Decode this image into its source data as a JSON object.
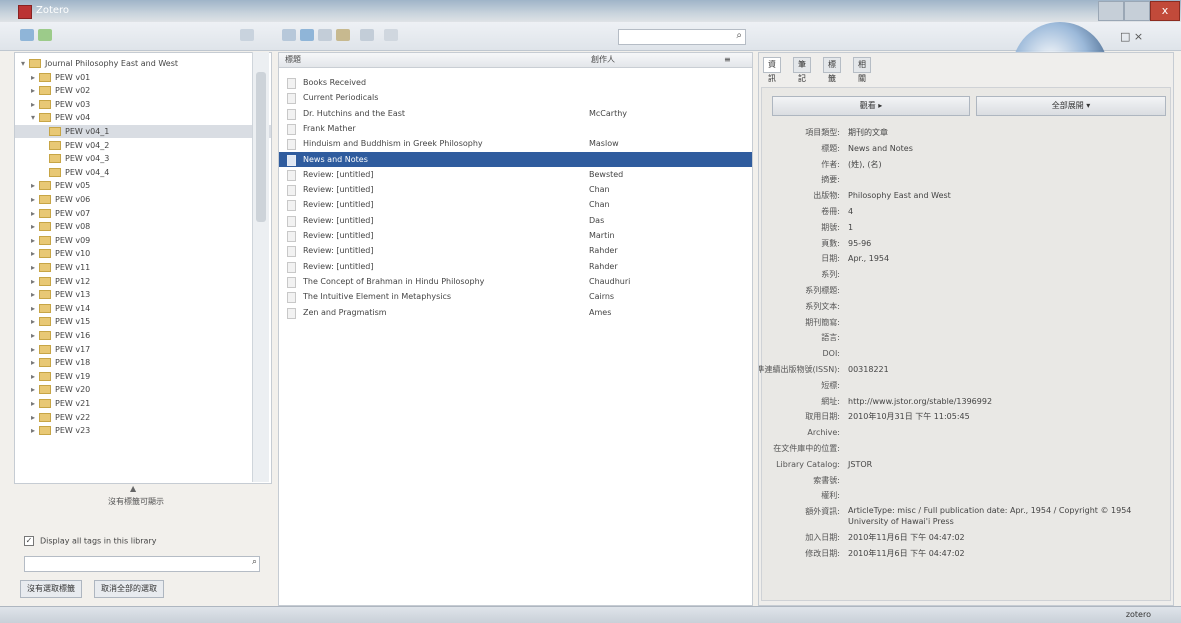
{
  "window": {
    "title": "Zotero",
    "close_label": "x"
  },
  "toolbar": {
    "search_placeholder": "",
    "search_icon": "search-icon"
  },
  "collections": [
    {
      "label": "Journal Philosophy East and West",
      "twisty": "▾",
      "level": 0
    },
    {
      "label": "PEW v01",
      "twisty": "▸",
      "level": 1
    },
    {
      "label": "PEW v02",
      "twisty": "▸",
      "level": 1
    },
    {
      "label": "PEW v03",
      "twisty": "▸",
      "level": 1
    },
    {
      "label": "PEW v04",
      "twisty": "▾",
      "level": 1
    },
    {
      "label": "PEW v04_1",
      "twisty": "",
      "level": 2
    },
    {
      "label": "PEW v04_2",
      "twisty": "",
      "level": 2
    },
    {
      "label": "PEW v04_3",
      "twisty": "",
      "level": 2
    },
    {
      "label": "PEW v04_4",
      "twisty": "",
      "level": 2
    },
    {
      "label": "PEW v05",
      "twisty": "▸",
      "level": 1
    },
    {
      "label": "PEW v06",
      "twisty": "▸",
      "level": 1
    },
    {
      "label": "PEW v07",
      "twisty": "▸",
      "level": 1
    },
    {
      "label": "PEW v08",
      "twisty": "▸",
      "level": 1
    },
    {
      "label": "PEW v09",
      "twisty": "▸",
      "level": 1
    },
    {
      "label": "PEW v10",
      "twisty": "▸",
      "level": 1
    },
    {
      "label": "PEW v11",
      "twisty": "▸",
      "level": 1
    },
    {
      "label": "PEW v12",
      "twisty": "▸",
      "level": 1
    },
    {
      "label": "PEW v13",
      "twisty": "▸",
      "level": 1
    },
    {
      "label": "PEW v14",
      "twisty": "▸",
      "level": 1
    },
    {
      "label": "PEW v15",
      "twisty": "▸",
      "level": 1
    },
    {
      "label": "PEW v16",
      "twisty": "▸",
      "level": 1
    },
    {
      "label": "PEW v17",
      "twisty": "▸",
      "level": 1
    },
    {
      "label": "PEW v18",
      "twisty": "▸",
      "level": 1
    },
    {
      "label": "PEW v19",
      "twisty": "▸",
      "level": 1
    },
    {
      "label": "PEW v20",
      "twisty": "▸",
      "level": 1
    },
    {
      "label": "PEW v21",
      "twisty": "▸",
      "level": 1
    },
    {
      "label": "PEW v22",
      "twisty": "▸",
      "level": 1
    },
    {
      "label": "PEW v23",
      "twisty": "▸",
      "level": 1
    }
  ],
  "selected_collection": 5,
  "splitter_label": "▲",
  "tag_selector": {
    "title": "沒有標籤可顯示",
    "checkbox_label": "Display all tags in this library",
    "checked": true,
    "check_mark": "✓",
    "filter_placeholder": "",
    "filter_icon": "search-icon",
    "buttons": [
      "沒有選取標籤",
      "取消全部的選取"
    ]
  },
  "items_header": {
    "title_col": "標題",
    "creator_col": "創作人",
    "picker": "≡"
  },
  "items": [
    {
      "title": "Books Received",
      "creator": ""
    },
    {
      "title": "Current Periodicals",
      "creator": ""
    },
    {
      "title": "Dr. Hutchins and the East",
      "creator": "McCarthy"
    },
    {
      "title": "Frank Mather",
      "creator": ""
    },
    {
      "title": "Hinduism and Buddhism in Greek Philosophy",
      "creator": "Maslow"
    },
    {
      "title": "News and Notes",
      "creator": ""
    },
    {
      "title": "Review: [untitled]",
      "creator": "Bewsted"
    },
    {
      "title": "Review: [untitled]",
      "creator": "Chan"
    },
    {
      "title": "Review: [untitled]",
      "creator": "Chan"
    },
    {
      "title": "Review: [untitled]",
      "creator": "Das"
    },
    {
      "title": "Review: [untitled]",
      "creator": "Martin"
    },
    {
      "title": "Review: [untitled]",
      "creator": "Rahder"
    },
    {
      "title": "Review: [untitled]",
      "creator": "Rahder"
    },
    {
      "title": "The Concept of Brahman in Hindu Philosophy",
      "creator": "Chaudhuri"
    },
    {
      "title": "The Intuitive Element in Metaphysics",
      "creator": "Cairns"
    },
    {
      "title": "Zen and Pragmatism",
      "creator": "Ames"
    }
  ],
  "selected_item": 5,
  "tabs": [
    "資訊",
    "筆記",
    "標籤",
    "相關的"
  ],
  "active_tab": 0,
  "info_buttons": [
    "觀看 ▸",
    "全部展開 ▾"
  ],
  "fields": [
    {
      "label": "項目類型:",
      "value": "期刊的文章"
    },
    {
      "label": "標題:",
      "value": "News and Notes"
    },
    {
      "label": "作者:",
      "value": "(姓), (名)"
    },
    {
      "label": "摘要:",
      "value": ""
    },
    {
      "label": "出版物:",
      "value": "Philosophy East and West"
    },
    {
      "label": "卷冊:",
      "value": "4"
    },
    {
      "label": "期號:",
      "value": "1"
    },
    {
      "label": "頁數:",
      "value": "95-96"
    },
    {
      "label": "日期:",
      "value": "Apr., 1954"
    },
    {
      "label": "系列:",
      "value": ""
    },
    {
      "label": "系列標題:",
      "value": ""
    },
    {
      "label": "系列文本:",
      "value": ""
    },
    {
      "label": "期刊簡寫:",
      "value": ""
    },
    {
      "label": "語言:",
      "value": ""
    },
    {
      "label": "DOI:",
      "value": ""
    },
    {
      "label": "國際標準連續出版物號(ISSN):",
      "value": "00318221"
    },
    {
      "label": "短標:",
      "value": ""
    },
    {
      "label": "網址:",
      "value": "http://www.jstor.org/stable/1396992"
    },
    {
      "label": "取用日期:",
      "value": "2010年10月31日 下午 11:05:45"
    },
    {
      "label": "Archive:",
      "value": ""
    },
    {
      "label": "在文件庫中的位置:",
      "value": ""
    },
    {
      "label": "Library Catalog:",
      "value": "JSTOR"
    },
    {
      "label": "索書號:",
      "value": ""
    },
    {
      "label": "權利:",
      "value": ""
    },
    {
      "label": "額外資訊:",
      "value": "ArticleType: misc / Full publication date: Apr., 1954 / Copyright © 1954 University of Hawai'i Press",
      "wrap": true
    },
    {
      "label": "加入日期:",
      "value": "2010年11月6日 下午 04:47:02"
    },
    {
      "label": "修改日期:",
      "value": "2010年11月6日 下午 04:47:02"
    }
  ],
  "statusbar": {
    "left": "",
    "right": "zotero"
  }
}
